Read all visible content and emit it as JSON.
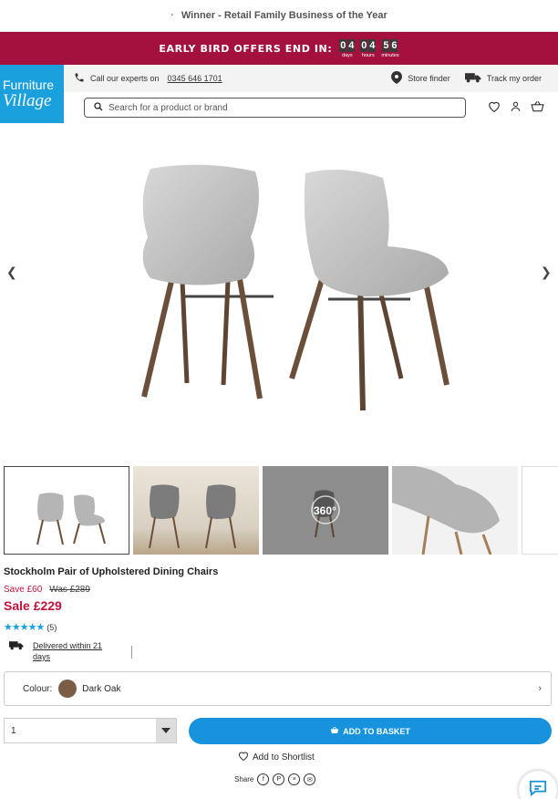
{
  "promo_bar": {
    "bullet": "·",
    "text": "Winner - Retail Family Business of the Year"
  },
  "countdown": {
    "label": "EARLY BIRD OFFERS END IN:",
    "days": [
      "0",
      "4"
    ],
    "days_label": "days",
    "hours": [
      "0",
      "4"
    ],
    "hours_label": "hours",
    "minutes": [
      "5",
      "6"
    ],
    "minutes_label": "minutes"
  },
  "logo": {
    "line1": "Furniture",
    "line2": "Village"
  },
  "infobar": {
    "call_text": "Call our experts on",
    "phone": "0345 646 1701",
    "store_finder": "Store finder",
    "track_order": "Track my order"
  },
  "search": {
    "placeholder": "Search for a product or brand"
  },
  "product": {
    "title": "Stockholm Pair of Upholstered Dining Chairs",
    "save": "Save £60",
    "was": "Was £289",
    "sale": "Sale £229",
    "stars": "★★★★★",
    "review_count": "(5)",
    "delivery": "Delivered within 21 days",
    "colour_label": "Colour:",
    "colour_value": "Dark Oak",
    "quantity": "1",
    "add_to_basket": "ADD TO BASKET",
    "add_to_shortlist": "Add to Shortlist",
    "share_label": "Share"
  },
  "thumbnails": {
    "view360_label": "360°"
  },
  "colors": {
    "brand_red": "#a5113f",
    "brand_blue": "#1ba0de",
    "sale_red": "#c4123e",
    "button_blue": "#1693dc"
  }
}
